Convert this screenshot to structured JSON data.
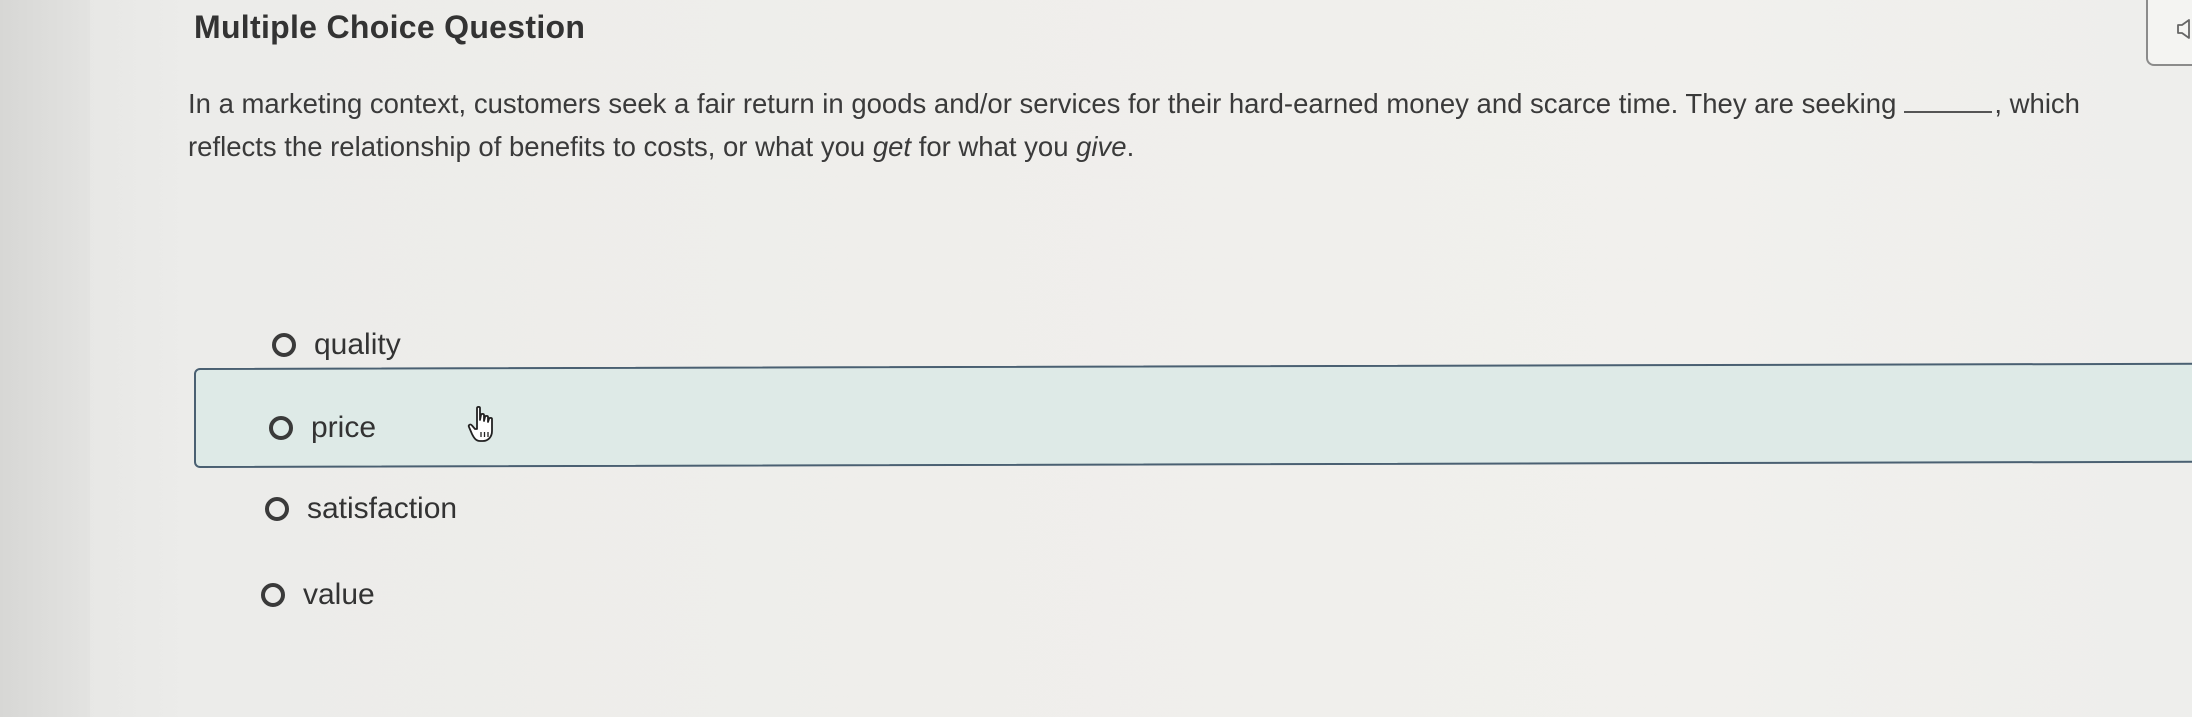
{
  "question": {
    "heading": "Multiple Choice Question",
    "line1_before_blank": "In a marketing context, customers seek a fair return in goods and/or services for their hard-earned money and scarce time. They are seeking",
    "line1_after_blank": ", which",
    "line2_start": "reflects the relationship of benefits to costs, or what you",
    "line2_em1": "get",
    "line2_mid": "for what you",
    "line2_em2": "give",
    "line2_end": "."
  },
  "options": [
    {
      "label": "quality",
      "selected": false,
      "hovered": false
    },
    {
      "label": "price",
      "selected": false,
      "hovered": true
    },
    {
      "label": "satisfaction",
      "selected": false,
      "hovered": false
    },
    {
      "label": "value",
      "selected": false,
      "hovered": false
    }
  ],
  "icons": {
    "audio": "speaker-icon",
    "cursor": "hand-pointer-icon",
    "option_marker": "radio-button-icon"
  },
  "colors": {
    "hover_background": "#deeae7",
    "hover_border": "#4a6072",
    "text": "#333333"
  }
}
